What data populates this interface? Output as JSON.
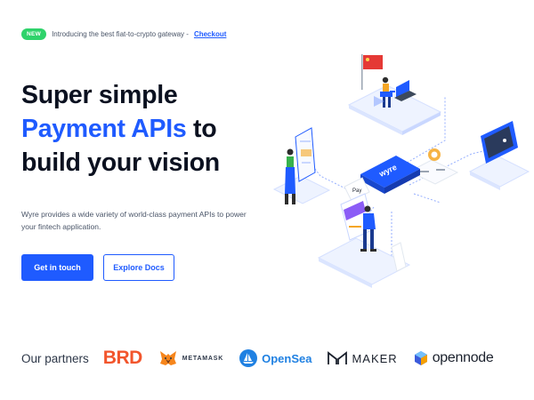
{
  "announcement": {
    "badge": "NEW",
    "text": "Introducing the best fiat-to-crypto gateway -",
    "link": "Checkout"
  },
  "hero": {
    "line1": "Super simple",
    "line2_accent": "Payment APIs",
    "line2_rest": " to",
    "line3": "build your vision",
    "description": "Wyre provides a wide variety of world-class payment APIs to power your fintech application."
  },
  "buttons": {
    "primary": "Get in touch",
    "secondary": "Explore Docs"
  },
  "illustration": {
    "card_label": "wyre",
    "pay_label": "Pay"
  },
  "partners": {
    "label": "Our partners",
    "logos": {
      "brd": "BRD",
      "metamask": "METAMASK",
      "opensea": "OpenSea",
      "maker": "MAKER",
      "opennode": "opennode"
    }
  },
  "colors": {
    "accent": "#1f5bff",
    "badge": "#2fd36b",
    "brd": "#f2552c",
    "opensea": "#2081e2"
  }
}
